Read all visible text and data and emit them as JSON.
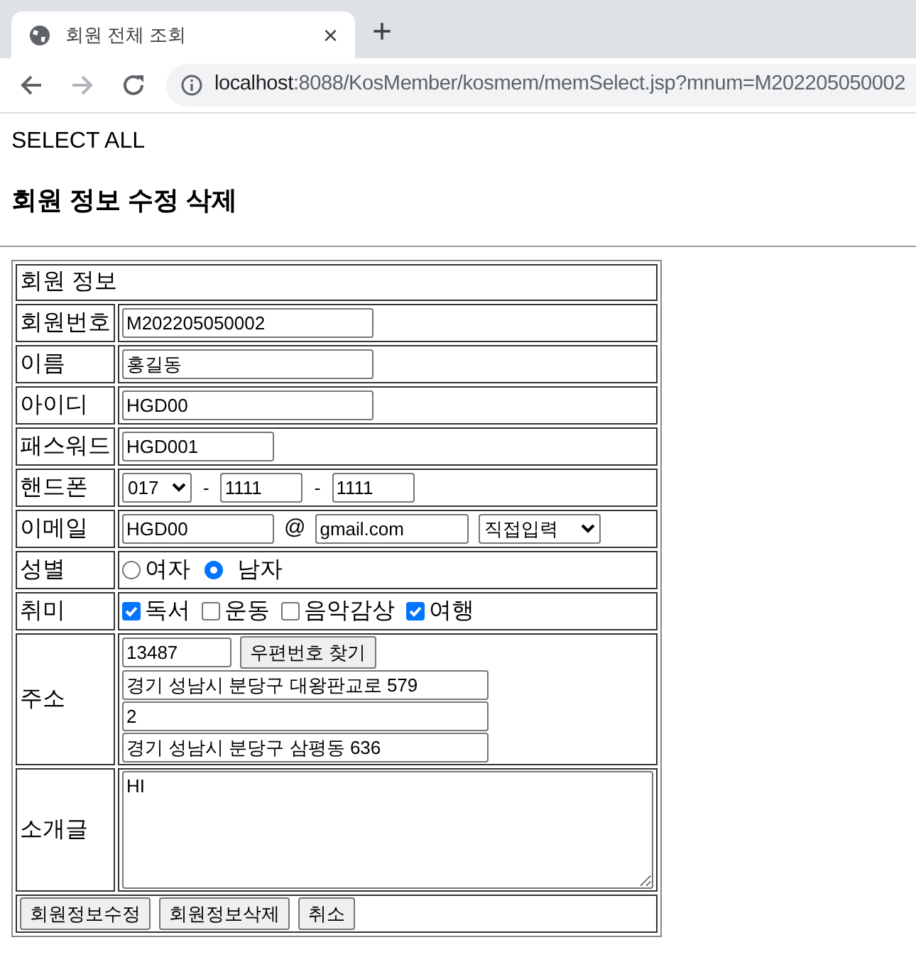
{
  "browser": {
    "tab": {
      "title": "회원 전체 조회",
      "close": "×",
      "new_tab": "+"
    },
    "address": {
      "host": "localhost",
      "path": ":8088/KosMember/kosmem/memSelect.jsp?mnum=M202205050002"
    }
  },
  "page": {
    "link": "SELECT ALL",
    "title": "회원 정보 수정 삭제"
  },
  "form": {
    "caption": "회원 정보",
    "rows": [
      {
        "kind": "long_text",
        "label": "회원번호",
        "value": "M202205050002"
      },
      {
        "kind": "long_text",
        "label": "이름",
        "value": "홍길동"
      },
      {
        "kind": "long_text",
        "label": "아이디",
        "value": "HGD00"
      },
      {
        "kind": "short_text",
        "label": "패스워드",
        "value": "HGD001"
      },
      {
        "kind": "phone",
        "label": "핸드폰",
        "prefix": "017",
        "sep": "-",
        "middle": "1111",
        "sep2": "-",
        "last": "1111"
      },
      {
        "kind": "email",
        "label": "이메일",
        "user": "HGD00",
        "at": "@",
        "domain": "gmail.com",
        "select": "직접입력"
      },
      {
        "kind": "radio",
        "label": "성별",
        "options": [
          {
            "label": "여자",
            "selected": false
          },
          {
            "label": "남자",
            "selected": true
          }
        ]
      },
      {
        "kind": "checkbox",
        "label": "취미",
        "options": [
          {
            "label": "독서",
            "checked": true
          },
          {
            "label": "운동",
            "checked": false
          },
          {
            "label": "음악감상",
            "checked": false
          },
          {
            "label": "여행",
            "checked": true
          }
        ]
      },
      {
        "kind": "address",
        "label": "주소",
        "zip": "13487",
        "button": "우편번호 찾기",
        "lines": [
          "경기 성남시 분당구 대왕판교로 579",
          "2",
          "경기 성남시 분당구 삼평동 636"
        ]
      },
      {
        "kind": "textarea",
        "label": "소개글",
        "value": "HI"
      }
    ],
    "buttons": [
      "회원정보수정",
      "회원정보삭제",
      "취소"
    ]
  }
}
